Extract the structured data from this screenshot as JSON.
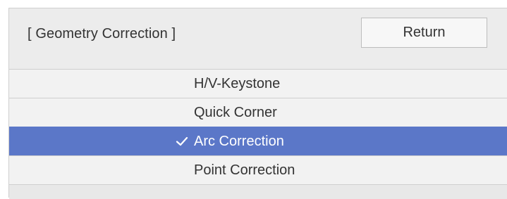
{
  "header": {
    "title": "[ Geometry Correction ]",
    "return_label": "Return"
  },
  "menu": {
    "items": [
      {
        "label": "H/V-Keystone",
        "selected": false
      },
      {
        "label": "Quick Corner",
        "selected": false
      },
      {
        "label": "Arc Correction",
        "selected": true
      },
      {
        "label": "Point Correction",
        "selected": false
      }
    ]
  },
  "colors": {
    "selection": "#5b77c8",
    "background": "#e8e8e8"
  },
  "icons": {
    "selected_marker": "checkmark-icon"
  }
}
